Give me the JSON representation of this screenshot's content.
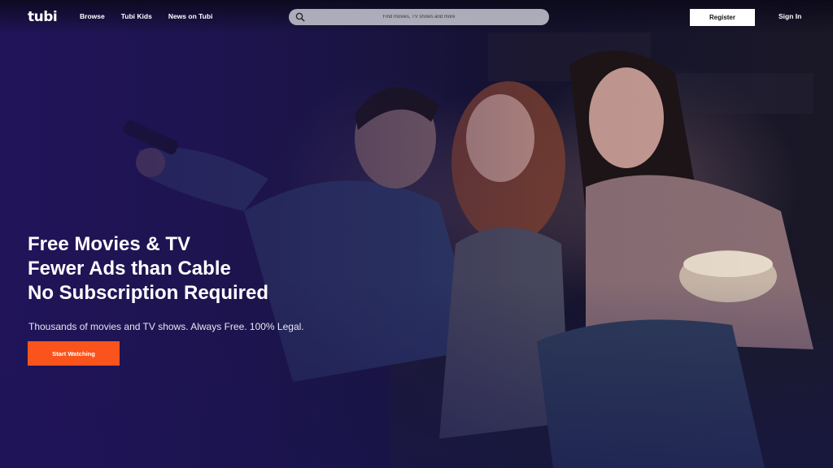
{
  "header": {
    "logo_text": "tubi",
    "nav": [
      {
        "label": "Browse"
      },
      {
        "label": "Tubi Kids"
      },
      {
        "label": "News on Tubi"
      }
    ],
    "search": {
      "placeholder": "Find movies, TV shows and more"
    },
    "register_label": "Register",
    "signin_label": "Sign In"
  },
  "hero": {
    "headline": [
      "Free Movies & TV",
      "Fewer Ads than Cable",
      "No Subscription Required"
    ],
    "subtext": "Thousands of movies and TV shows. Always Free. 100% Legal.",
    "cta_label": "Start Watching"
  },
  "colors": {
    "accent": "#fa541c",
    "background": "#1f1450"
  },
  "icons": {
    "search": "search-icon"
  }
}
